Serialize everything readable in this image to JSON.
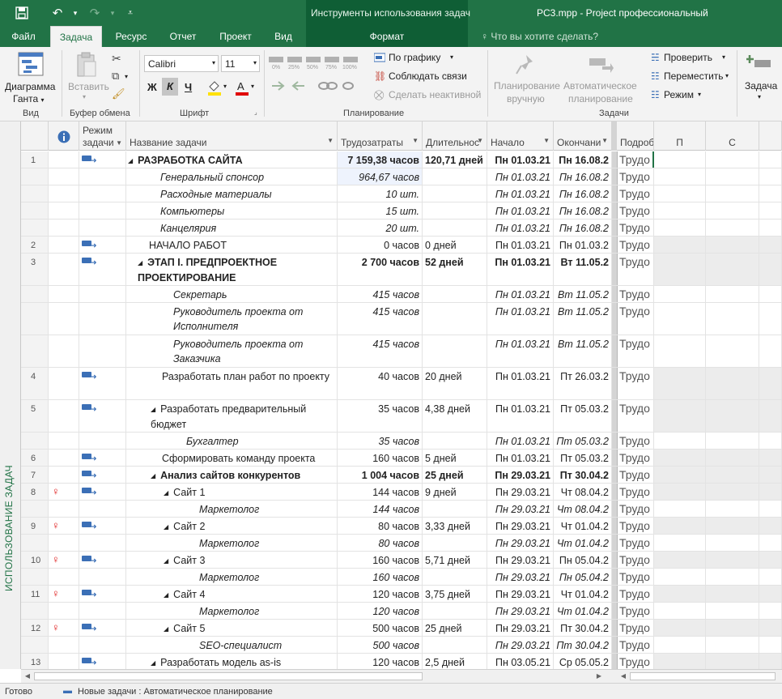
{
  "titlebar": {
    "contextual_title": "Инструменты использования задач",
    "app_title": "PC3.mpp - Project профессиональный",
    "brand_color": "#217346"
  },
  "tabs": {
    "file": "Файл",
    "task": "Задача",
    "resource": "Ресурс",
    "report": "Отчет",
    "project": "Проект",
    "view": "Вид",
    "format": "Формат",
    "search": "Что вы хотите сделать?"
  },
  "ribbon": {
    "gantt_1": "Диаграмма",
    "gantt_2": "Ганта",
    "paste": "Вставить",
    "font_name": "Calibri",
    "font_size": "11",
    "bold": "Ж",
    "italic": "К",
    "underline": "Ч",
    "on_schedule": "По графику",
    "respect_links": "Соблюдать связи",
    "inactivate": "Сделать неактивной",
    "manual_1": "Планирование",
    "manual_2": "вручную",
    "auto_1": "Автоматическое",
    "auto_2": "планирование",
    "inspect": "Проверить",
    "move": "Переместить",
    "mode": "Режим",
    "task_btn": "Задача",
    "pct_0": "0%",
    "pct_25": "25%",
    "pct_50": "50%",
    "pct_75": "75%",
    "pct_100": "100%",
    "groups": {
      "view": "Вид",
      "clipboard": "Буфер обмена",
      "font": "Шрифт",
      "schedule": "Планирование",
      "tasks": "Задачи"
    }
  },
  "view_label": "ИСПОЛЬЗОВАНИЕ ЗАДАЧ",
  "columns": {
    "mode_1": "Режим",
    "mode_2": "задачи",
    "name": "Название задачи",
    "work": "Трудозатраты",
    "duration": "Длительнос",
    "start": "Начало",
    "finish": "Окончани",
    "details": "Подробно",
    "p": "П",
    "s": "С"
  },
  "rows": [
    {
      "id": "1",
      "mode": true,
      "indicator": false,
      "level": 0,
      "tri": true,
      "name": "РАЗРАБОТКА САЙТА",
      "work": "7 159,38 часов",
      "dur": "120,71 дней",
      "start": "Пн 01.03.21",
      "finish": "Пн 16.08.2",
      "bold": true,
      "ital": false,
      "h": 21,
      "summary": false,
      "hl": true
    },
    {
      "id": "",
      "mode": false,
      "indicator": false,
      "level": 1,
      "tri": false,
      "name": "Генеральный спонсор",
      "work": "964,67 часов",
      "dur": "",
      "start": "Пн 01.03.21",
      "finish": "Пн 16.08.2",
      "bold": false,
      "ital": true,
      "h": 21,
      "summary": false,
      "hl": true
    },
    {
      "id": "",
      "mode": false,
      "indicator": false,
      "level": 1,
      "tri": false,
      "name": "Расходные материалы",
      "work": "10 шт.",
      "dur": "",
      "start": "Пн 01.03.21",
      "finish": "Пн 16.08.2",
      "bold": false,
      "ital": true,
      "h": 21,
      "summary": false,
      "hl": false
    },
    {
      "id": "",
      "mode": false,
      "indicator": false,
      "level": 1,
      "tri": false,
      "name": "Компьютеры",
      "work": "15 шт.",
      "dur": "",
      "start": "Пн 01.03.21",
      "finish": "Пн 16.08.2",
      "bold": false,
      "ital": true,
      "h": 21,
      "summary": false,
      "hl": false
    },
    {
      "id": "",
      "mode": false,
      "indicator": false,
      "level": 1,
      "tri": false,
      "name": "Канцелярия",
      "work": "20 шт.",
      "dur": "",
      "start": "Пн 01.03.21",
      "finish": "Пн 16.08.2",
      "bold": false,
      "ital": true,
      "h": 21,
      "summary": false,
      "hl": false
    },
    {
      "id": "2",
      "mode": true,
      "indicator": false,
      "level": 1,
      "tri": false,
      "name": "НАЧАЛО РАБОТ",
      "work": "0 часов",
      "dur": "0 дней",
      "start": "Пн 01.03.21",
      "finish": "Пн 01.03.2",
      "bold": false,
      "ital": false,
      "h": 21,
      "summary": true,
      "hl": false
    },
    {
      "id": "3",
      "mode": true,
      "indicator": false,
      "level": 1,
      "tri": true,
      "name": "ЭТАП I. ПРЕДПРОЕКТНОЕ ПРОЕКТИРОВАНИЕ",
      "work": "2 700 часов",
      "dur": "52 дней",
      "start": "Пн 01.03.21",
      "finish": "Вт 11.05.2",
      "bold": true,
      "ital": false,
      "h": 40,
      "summary": true,
      "hl": false
    },
    {
      "id": "",
      "mode": false,
      "indicator": false,
      "level": 2,
      "tri": false,
      "name": "Секретарь",
      "work": "415 часов",
      "dur": "",
      "start": "Пн 01.03.21",
      "finish": "Вт 11.05.2",
      "bold": false,
      "ital": true,
      "h": 21,
      "summary": false,
      "hl": false
    },
    {
      "id": "",
      "mode": false,
      "indicator": false,
      "level": 2,
      "tri": false,
      "name": "Руководитель проекта от Исполнителя",
      "work": "415 часов",
      "dur": "",
      "start": "Пн 01.03.21",
      "finish": "Вт 11.05.2",
      "bold": false,
      "ital": true,
      "h": 40,
      "summary": false,
      "hl": false
    },
    {
      "id": "",
      "mode": false,
      "indicator": false,
      "level": 2,
      "tri": false,
      "name": "Руководитель проекта от Заказчика",
      "work": "415 часов",
      "dur": "",
      "start": "Пн 01.03.21",
      "finish": "Вт 11.05.2",
      "bold": false,
      "ital": true,
      "h": 40,
      "summary": false,
      "hl": false
    },
    {
      "id": "4",
      "mode": true,
      "indicator": false,
      "level": 2,
      "tri": false,
      "name": "Разработать план работ по проекту",
      "work": "40 часов",
      "dur": "20 дней",
      "start": "Пн 01.03.21",
      "finish": "Пт 26.03.2",
      "bold": false,
      "ital": false,
      "h": 40,
      "summary": true,
      "hl": false
    },
    {
      "id": "5",
      "mode": true,
      "indicator": false,
      "level": 2,
      "tri": true,
      "name": "Разработать предварительный бюджет",
      "work": "35 часов",
      "dur": "4,38 дней",
      "start": "Пн 01.03.21",
      "finish": "Пт 05.03.2",
      "bold": false,
      "ital": false,
      "h": 40,
      "summary": true,
      "hl": false
    },
    {
      "id": "",
      "mode": false,
      "indicator": false,
      "level": 3,
      "tri": false,
      "name": "Бухгалтер",
      "work": "35 часов",
      "dur": "",
      "start": "Пн 01.03.21",
      "finish": "Пт 05.03.2",
      "bold": false,
      "ital": true,
      "h": 21,
      "summary": false,
      "hl": false
    },
    {
      "id": "6",
      "mode": true,
      "indicator": false,
      "level": 2,
      "tri": false,
      "name": "Сформировать команду проекта",
      "work": "160 часов",
      "dur": "5 дней",
      "start": "Пн 01.03.21",
      "finish": "Пт 05.03.2",
      "bold": false,
      "ital": false,
      "h": 21,
      "summary": true,
      "hl": false
    },
    {
      "id": "7",
      "mode": true,
      "indicator": false,
      "level": 2,
      "tri": true,
      "name": "Анализ сайтов конкурентов",
      "work": "1 004 часов",
      "dur": "25 дней",
      "start": "Пн 29.03.21",
      "finish": "Пт 30.04.2",
      "bold": true,
      "ital": false,
      "h": 21,
      "summary": true,
      "hl": false
    },
    {
      "id": "8",
      "mode": true,
      "indicator": true,
      "level": 3,
      "tri": true,
      "name": "Сайт 1",
      "work": "144 часов",
      "dur": "9 дней",
      "start": "Пн 29.03.21",
      "finish": "Чт 08.04.2",
      "bold": false,
      "ital": false,
      "h": 21,
      "summary": true,
      "hl": false
    },
    {
      "id": "",
      "mode": false,
      "indicator": false,
      "level": 4,
      "tri": false,
      "name": "Маркетолог",
      "work": "144 часов",
      "dur": "",
      "start": "Пн 29.03.21",
      "finish": "Чт 08.04.2",
      "bold": false,
      "ital": true,
      "h": 21,
      "summary": false,
      "hl": false
    },
    {
      "id": "9",
      "mode": true,
      "indicator": true,
      "level": 3,
      "tri": true,
      "name": "Сайт 2",
      "work": "80 часов",
      "dur": "3,33 дней",
      "start": "Пн 29.03.21",
      "finish": "Чт 01.04.2",
      "bold": false,
      "ital": false,
      "h": 21,
      "summary": true,
      "hl": false
    },
    {
      "id": "",
      "mode": false,
      "indicator": false,
      "level": 4,
      "tri": false,
      "name": "Маркетолог",
      "work": "80 часов",
      "dur": "",
      "start": "Пн 29.03.21",
      "finish": "Чт 01.04.2",
      "bold": false,
      "ital": true,
      "h": 21,
      "summary": false,
      "hl": false
    },
    {
      "id": "10",
      "mode": true,
      "indicator": true,
      "level": 3,
      "tri": true,
      "name": "Сайт 3",
      "work": "160 часов",
      "dur": "5,71 дней",
      "start": "Пн 29.03.21",
      "finish": "Пн 05.04.2",
      "bold": false,
      "ital": false,
      "h": 21,
      "summary": true,
      "hl": false
    },
    {
      "id": "",
      "mode": false,
      "indicator": false,
      "level": 4,
      "tri": false,
      "name": "Маркетолог",
      "work": "160 часов",
      "dur": "",
      "start": "Пн 29.03.21",
      "finish": "Пн 05.04.2",
      "bold": false,
      "ital": true,
      "h": 21,
      "summary": false,
      "hl": false
    },
    {
      "id": "11",
      "mode": true,
      "indicator": true,
      "level": 3,
      "tri": true,
      "name": "Сайт 4",
      "work": "120 часов",
      "dur": "3,75 дней",
      "start": "Пн 29.03.21",
      "finish": "Чт 01.04.2",
      "bold": false,
      "ital": false,
      "h": 21,
      "summary": true,
      "hl": false
    },
    {
      "id": "",
      "mode": false,
      "indicator": false,
      "level": 4,
      "tri": false,
      "name": "Маркетолог",
      "work": "120 часов",
      "dur": "",
      "start": "Пн 29.03.21",
      "finish": "Чт 01.04.2",
      "bold": false,
      "ital": true,
      "h": 21,
      "summary": false,
      "hl": false
    },
    {
      "id": "12",
      "mode": true,
      "indicator": true,
      "level": 3,
      "tri": true,
      "name": "Сайт 5",
      "work": "500 часов",
      "dur": "25 дней",
      "start": "Пн 29.03.21",
      "finish": "Пт 30.04.2",
      "bold": false,
      "ital": false,
      "h": 21,
      "summary": true,
      "hl": false
    },
    {
      "id": "",
      "mode": false,
      "indicator": false,
      "level": 4,
      "tri": false,
      "name": "SEO-специалист",
      "work": "500 часов",
      "dur": "",
      "start": "Пн 29.03.21",
      "finish": "Пт 30.04.2",
      "bold": false,
      "ital": true,
      "h": 21,
      "summary": false,
      "hl": false
    },
    {
      "id": "13",
      "mode": true,
      "indicator": false,
      "level": 2,
      "tri": true,
      "name": "Разработать модель as-is",
      "work": "120 часов",
      "dur": "2,5 дней",
      "start": "Пн 03.05.21",
      "finish": "Ср 05.05.2",
      "bold": false,
      "ital": false,
      "h": 21,
      "summary": true,
      "hl": false
    }
  ],
  "detail_label": "Трудо",
  "status": {
    "ready": "Готово",
    "new_tasks": "Новые задачи : Автоматическое планирование"
  }
}
